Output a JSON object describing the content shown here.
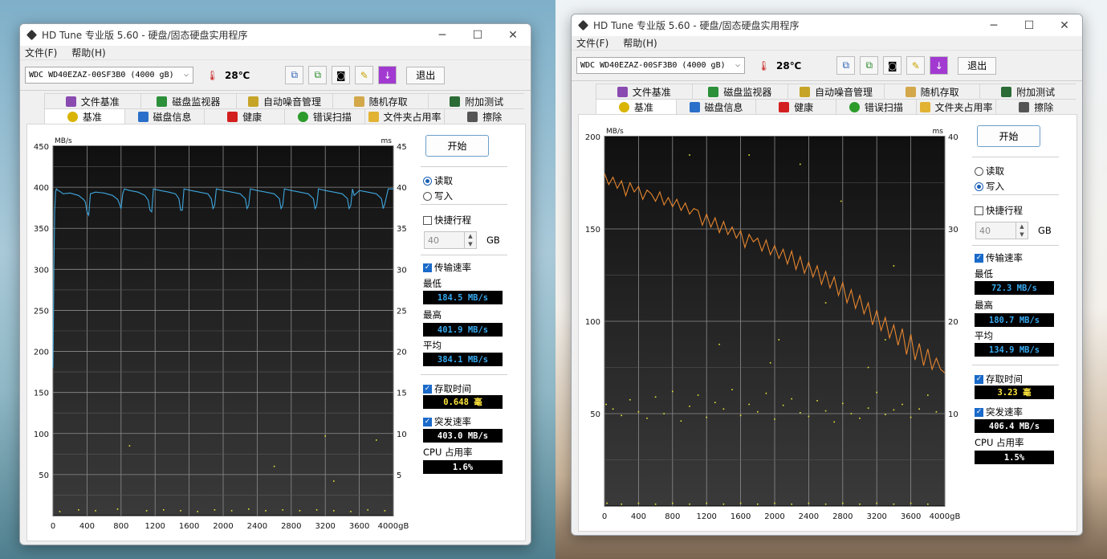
{
  "windows": [
    {
      "title": "HD Tune 专业版 5.60 - 硬盘/固态硬盘实用程序",
      "menu": [
        "文件(F)",
        "帮助(H)"
      ],
      "drive": "WDC WD40EZAZ-00SF3B0 (4000 gB)",
      "temperature": "28℃",
      "exit_label": "退出",
      "tabs_row1": [
        "文件基准",
        "磁盘监视器",
        "自动噪音管理",
        "随机存取",
        "附加测试"
      ],
      "tabs_row2": [
        "基准",
        "磁盘信息",
        "健康",
        "错误扫描",
        "文件夹占用率",
        "擦除"
      ],
      "start_label": "开始",
      "read_label": "读取",
      "write_label": "写入",
      "mode": "read",
      "short_stroke_label": "快捷行程",
      "short_stroke_value": "40",
      "gb_unit": "GB",
      "transfer_label": "传输速率",
      "min_label": "最低",
      "min_value": "184.5 MB/s",
      "max_label": "最高",
      "max_value": "401.9 MB/s",
      "avg_label": "平均",
      "avg_value": "384.1 MB/s",
      "access_label": "存取时间",
      "access_value": "0.648 毫",
      "burst_label": "突发速率",
      "burst_value": "403.0 MB/s",
      "cpu_label": "CPU 占用率",
      "cpu_value": "1.6%",
      "colors": {
        "transfer": "#3ea6dd",
        "access": "#e8e83a"
      },
      "chart_data": {
        "type": "line",
        "ylabel": "MB/s",
        "y2label": "ms",
        "xlabel": "gB",
        "x_ticks": [
          "0",
          "400",
          "800",
          "1200",
          "1600",
          "2000",
          "2400",
          "2800",
          "3200",
          "3600",
          "4000gB"
        ],
        "y_ticks": [
          "450",
          "400",
          "350",
          "300",
          "250",
          "200",
          "150",
          "100",
          "50"
        ],
        "y2_ticks": [
          "45",
          "40",
          "35",
          "30",
          "25",
          "20",
          "15",
          "10",
          "5"
        ],
        "xlim": [
          0,
          4000
        ],
        "ylim": [
          0,
          450
        ],
        "y2lim": [
          0,
          45
        ],
        "series": [
          {
            "x": [
              0,
              10,
              20,
              30,
              40,
              60,
              80,
              120,
              200,
              300,
              360,
              380,
              400,
              420,
              440,
              500,
              600,
              700,
              760,
              780,
              800,
              820,
              840,
              900,
              1000,
              1080,
              1120,
              1140,
              1160,
              1180,
              1260,
              1360,
              1440,
              1480,
              1500,
              1520,
              1540,
              1620,
              1720,
              1820,
              1860,
              1880,
              1900,
              1920,
              2000,
              2100,
              2200,
              2260,
              2280,
              2300,
              2320,
              2400,
              2500,
              2600,
              2660,
              2680,
              2700,
              2720,
              2800,
              2900,
              3000,
              3060,
              3080,
              3100,
              3120,
              3200,
              3300,
              3400,
              3460,
              3480,
              3500,
              3520,
              3540,
              3600,
              3700,
              3800,
              3860,
              3880,
              3900,
              3940,
              4000
            ],
            "values": [
              180,
              300,
              370,
              394,
              398,
              396,
              395,
              392,
              393,
              390,
              385,
              382,
              370,
              366,
              392,
              394,
              393,
              390,
              385,
              380,
              374,
              392,
              398,
              396,
              394,
              390,
              384,
              372,
              370,
              398,
              396,
              394,
              392,
              386,
              372,
              372,
              398,
              396,
              394,
              392,
              386,
              374,
              378,
              398,
              396,
              394,
              392,
              386,
              374,
              378,
              398,
              396,
              394,
              392,
              386,
              374,
              378,
              398,
              396,
              394,
              392,
              386,
              374,
              378,
              398,
              396,
              394,
              392,
              386,
              374,
              378,
              398,
              390,
              396,
              394,
              392,
              386,
              374,
              380,
              398,
              398
            ]
          }
        ],
        "access_points": [
          {
            "x": 80,
            "y": 0.5
          },
          {
            "x": 300,
            "y": 0.7
          },
          {
            "x": 500,
            "y": 0.6
          },
          {
            "x": 760,
            "y": 0.8
          },
          {
            "x": 900,
            "y": 8.5
          },
          {
            "x": 1100,
            "y": 0.6
          },
          {
            "x": 1300,
            "y": 0.7
          },
          {
            "x": 1500,
            "y": 0.6
          },
          {
            "x": 1700,
            "y": 0.5
          },
          {
            "x": 1900,
            "y": 0.7
          },
          {
            "x": 2100,
            "y": 0.6
          },
          {
            "x": 2300,
            "y": 0.8
          },
          {
            "x": 2500,
            "y": 0.6
          },
          {
            "x": 2600,
            "y": 6
          },
          {
            "x": 2700,
            "y": 0.7
          },
          {
            "x": 2900,
            "y": 0.6
          },
          {
            "x": 3100,
            "y": 0.7
          },
          {
            "x": 3200,
            "y": 9.7
          },
          {
            "x": 3300,
            "y": 0.6
          },
          {
            "x": 3300,
            "y": 4.2
          },
          {
            "x": 3500,
            "y": 0.5
          },
          {
            "x": 3700,
            "y": 0.7
          },
          {
            "x": 3800,
            "y": 9.2
          },
          {
            "x": 3900,
            "y": 0.6
          }
        ]
      }
    },
    {
      "title": "HD Tune 专业版 5.60 - 硬盘/固态硬盘实用程序",
      "menu": [
        "文件(F)",
        "帮助(H)"
      ],
      "drive": "WDC WD40EZAZ-00SF3B0 (4000 gB)",
      "temperature": "28℃",
      "exit_label": "退出",
      "tabs_row1": [
        "文件基准",
        "磁盘监视器",
        "自动噪音管理",
        "随机存取",
        "附加测试"
      ],
      "tabs_row2": [
        "基准",
        "磁盘信息",
        "健康",
        "错误扫描",
        "文件夹占用率",
        "擦除"
      ],
      "start_label": "开始",
      "read_label": "读取",
      "write_label": "写入",
      "mode": "write",
      "short_stroke_label": "快捷行程",
      "short_stroke_value": "40",
      "gb_unit": "GB",
      "transfer_label": "传输速率",
      "min_label": "最低",
      "min_value": "72.3 MB/s",
      "max_label": "最高",
      "max_value": "180.7 MB/s",
      "avg_label": "平均",
      "avg_value": "134.9 MB/s",
      "access_label": "存取时间",
      "access_value": "3.23 毫",
      "burst_label": "突发速率",
      "burst_value": "406.4 MB/s",
      "cpu_label": "CPU 占用率",
      "cpu_value": "1.5%",
      "colors": {
        "transfer": "#e7862e",
        "access": "#e8e83a"
      },
      "chart_data": {
        "type": "line",
        "ylabel": "MB/s",
        "y2label": "ms",
        "xlabel": "gB",
        "x_ticks": [
          "0",
          "400",
          "800",
          "1200",
          "1600",
          "2000",
          "2400",
          "2800",
          "3200",
          "3600",
          "4000gB"
        ],
        "y_ticks": [
          "200",
          "150",
          "100",
          "50"
        ],
        "y2_ticks": [
          "40",
          "30",
          "20",
          "10"
        ],
        "xlim": [
          0,
          4000
        ],
        "ylim": [
          0,
          200
        ],
        "y2lim": [
          0,
          40
        ],
        "series": [
          {
            "x": [
              0,
              50,
              100,
              150,
              200,
              250,
              300,
              350,
              400,
              450,
              500,
              550,
              600,
              650,
              700,
              750,
              800,
              850,
              900,
              950,
              1000,
              1050,
              1100,
              1150,
              1200,
              1250,
              1300,
              1350,
              1400,
              1450,
              1500,
              1550,
              1600,
              1650,
              1700,
              1750,
              1800,
              1850,
              1900,
              1950,
              2000,
              2050,
              2100,
              2150,
              2200,
              2250,
              2300,
              2350,
              2400,
              2450,
              2500,
              2550,
              2600,
              2650,
              2700,
              2750,
              2800,
              2850,
              2900,
              2950,
              3000,
              3050,
              3100,
              3150,
              3200,
              3250,
              3300,
              3350,
              3400,
              3450,
              3500,
              3550,
              3600,
              3650,
              3700,
              3750,
              3800,
              3850,
              3900,
              3950,
              4000
            ],
            "values": [
              180,
              174,
              178,
              172,
              176,
              168,
              175,
              170,
              173,
              166,
              171,
              169,
              165,
              170,
              163,
              167,
              162,
              166,
              160,
              164,
              158,
              161,
              160,
              152,
              158,
              151,
              156,
              148,
              154,
              147,
              151,
              145,
              149,
              140,
              147,
              143,
              145,
              138,
              144,
              136,
              141,
              134,
              139,
              131,
              138,
              128,
              135,
              126,
              132,
              124,
              130,
              120,
              127,
              118,
              124,
              114,
              121,
              110,
              117,
              107,
              114,
              104,
              110,
              98,
              106,
              95,
              102,
              91,
              98,
              87,
              96,
              82,
              93,
              79,
              88,
              76,
              85,
              74,
              80,
              74,
              72
            ]
          }
        ],
        "access_points": [
          {
            "x": 20,
            "y": 11
          },
          {
            "x": 100,
            "y": 10.5
          },
          {
            "x": 200,
            "y": 9.8
          },
          {
            "x": 300,
            "y": 11.5
          },
          {
            "x": 400,
            "y": 10.2
          },
          {
            "x": 500,
            "y": 9.5
          },
          {
            "x": 600,
            "y": 11.8
          },
          {
            "x": 700,
            "y": 10
          },
          {
            "x": 800,
            "y": 12.4
          },
          {
            "x": 900,
            "y": 9.2
          },
          {
            "x": 1000,
            "y": 10.8
          },
          {
            "x": 1100,
            "y": 12
          },
          {
            "x": 1200,
            "y": 9.6
          },
          {
            "x": 1300,
            "y": 11.2
          },
          {
            "x": 1400,
            "y": 10.5
          },
          {
            "x": 1500,
            "y": 12.6
          },
          {
            "x": 1600,
            "y": 9.8
          },
          {
            "x": 1700,
            "y": 11
          },
          {
            "x": 1800,
            "y": 10.2
          },
          {
            "x": 1900,
            "y": 12.2
          },
          {
            "x": 2000,
            "y": 9.4
          },
          {
            "x": 2100,
            "y": 10.9
          },
          {
            "x": 2200,
            "y": 11.6
          },
          {
            "x": 2300,
            "y": 10.1
          },
          {
            "x": 2400,
            "y": 9.7
          },
          {
            "x": 2500,
            "y": 11.4
          },
          {
            "x": 2600,
            "y": 10.3
          },
          {
            "x": 2700,
            "y": 9.1
          },
          {
            "x": 2800,
            "y": 11.1
          },
          {
            "x": 2900,
            "y": 10
          },
          {
            "x": 3000,
            "y": 9.5
          },
          {
            "x": 3100,
            "y": 10.6
          },
          {
            "x": 3200,
            "y": 12.3
          },
          {
            "x": 3300,
            "y": 9.9
          },
          {
            "x": 3400,
            "y": 10.4
          },
          {
            "x": 3500,
            "y": 11
          },
          {
            "x": 3600,
            "y": 9.6
          },
          {
            "x": 3700,
            "y": 10.5
          },
          {
            "x": 3800,
            "y": 12
          },
          {
            "x": 3900,
            "y": 10.2
          },
          {
            "x": 1000,
            "y": 38
          },
          {
            "x": 2300,
            "y": 37
          },
          {
            "x": 2780,
            "y": 33
          },
          {
            "x": 1350,
            "y": 17.5
          },
          {
            "x": 1950,
            "y": 15.5
          },
          {
            "x": 2050,
            "y": 18
          },
          {
            "x": 2600,
            "y": 22
          },
          {
            "x": 3300,
            "y": 18
          },
          {
            "x": 1700,
            "y": 38
          },
          {
            "x": 3100,
            "y": 15
          },
          {
            "x": 3400,
            "y": 26
          },
          {
            "x": 30,
            "y": 0.3
          },
          {
            "x": 200,
            "y": 0.2
          },
          {
            "x": 400,
            "y": 0.3
          },
          {
            "x": 600,
            "y": 0.2
          },
          {
            "x": 800,
            "y": 0.3
          },
          {
            "x": 1000,
            "y": 0.2
          },
          {
            "x": 1200,
            "y": 0.3
          },
          {
            "x": 1400,
            "y": 0.2
          },
          {
            "x": 1600,
            "y": 0.3
          },
          {
            "x": 1800,
            "y": 0.2
          },
          {
            "x": 2000,
            "y": 0.3
          },
          {
            "x": 2200,
            "y": 0.2
          },
          {
            "x": 2400,
            "y": 0.3
          },
          {
            "x": 2600,
            "y": 0.2
          },
          {
            "x": 2800,
            "y": 0.3
          },
          {
            "x": 3000,
            "y": 0.2
          },
          {
            "x": 3200,
            "y": 0.3
          },
          {
            "x": 3400,
            "y": 0.2
          },
          {
            "x": 3600,
            "y": 0.3
          },
          {
            "x": 3800,
            "y": 0.2
          }
        ]
      }
    }
  ]
}
